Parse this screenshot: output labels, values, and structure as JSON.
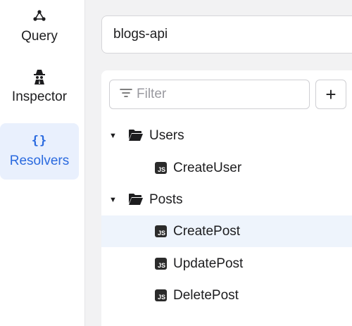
{
  "sidebar": {
    "items": [
      {
        "label": "Query",
        "icon": "graphql-icon"
      },
      {
        "label": "Inspector",
        "icon": "spy-icon"
      },
      {
        "label": "Resolvers",
        "icon": "braces-icon",
        "active": true
      }
    ]
  },
  "api": {
    "name": "blogs-api"
  },
  "panel": {
    "filter_placeholder": "Filter",
    "add_label": "+",
    "js_badge": "JS",
    "tree": [
      {
        "folder": "Users",
        "files": [
          "CreateUser"
        ]
      },
      {
        "folder": "Posts",
        "files": [
          "CreatePost",
          "UpdatePost",
          "DeletePost"
        ]
      }
    ],
    "selected_file": "CreatePost"
  },
  "colors": {
    "accent": "#2a6adf",
    "active_bg": "#e9f0fd",
    "selected_row": "#eef4fc"
  }
}
